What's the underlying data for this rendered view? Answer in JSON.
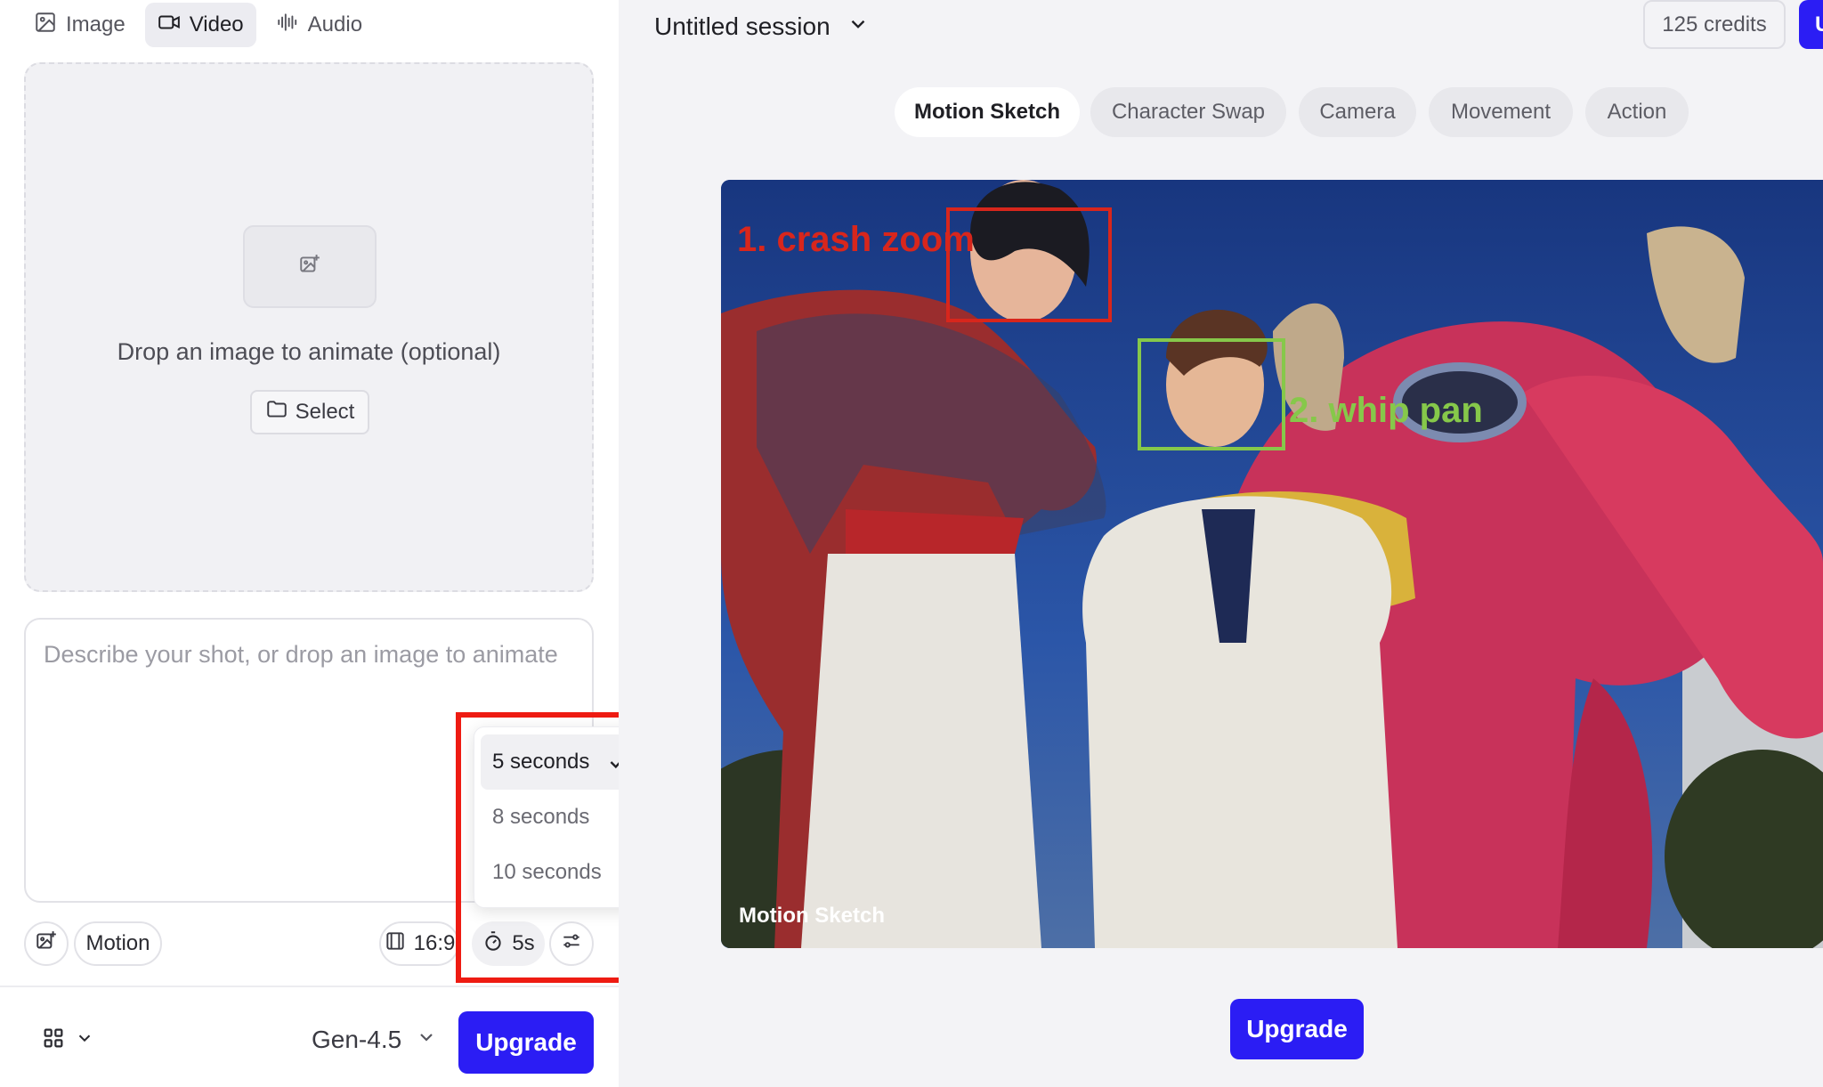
{
  "mode_tabs": [
    {
      "label": "Image",
      "icon": "image-icon",
      "active": false
    },
    {
      "label": "Video",
      "icon": "video-icon",
      "active": true
    },
    {
      "label": "Audio",
      "icon": "audio-waveform-icon",
      "active": false
    }
  ],
  "dropzone": {
    "icon": "add-image-icon",
    "text": "Drop an image to animate (optional)",
    "select_label": "Select",
    "select_icon": "folder-icon"
  },
  "prompt": {
    "placeholder": "Describe your shot, or drop an image to animate",
    "value": ""
  },
  "controls": {
    "image_button_icon": "add-image-icon",
    "motion_label": "Motion",
    "aspect_label": "16:9",
    "aspect_icon": "aspect-ratio-icon",
    "duration_label": "5s",
    "duration_icon": "stopwatch-icon",
    "settings_icon": "sliders-icon"
  },
  "duration_menu": {
    "options": [
      {
        "label": "5 seconds",
        "selected": true
      },
      {
        "label": "8 seconds",
        "selected": false
      },
      {
        "label": "10 seconds",
        "selected": false
      }
    ]
  },
  "footer": {
    "grid_icon": "grid-icon",
    "model": "Gen-4.5",
    "upgrade_label": "Upgrade"
  },
  "header": {
    "session_title": "Untitled session",
    "credits": "125 credits",
    "upgrade_label_partial": "U"
  },
  "preset_chips": [
    {
      "label": "Motion Sketch",
      "active": true
    },
    {
      "label": "Character Swap",
      "active": false
    },
    {
      "label": "Camera",
      "active": false
    },
    {
      "label": "Movement",
      "active": false
    },
    {
      "label": "Action",
      "active": false
    }
  ],
  "preview": {
    "annotation_1": "1. crash zoom",
    "annotation_2": "2. whip pan",
    "caption": "Motion Sketch",
    "upgrade_label": "Upgrade"
  },
  "colors": {
    "accent": "#2b1df4",
    "highlight_red": "#ee1b12",
    "annotation_red": "#d8261c",
    "annotation_green": "#86c84a"
  }
}
